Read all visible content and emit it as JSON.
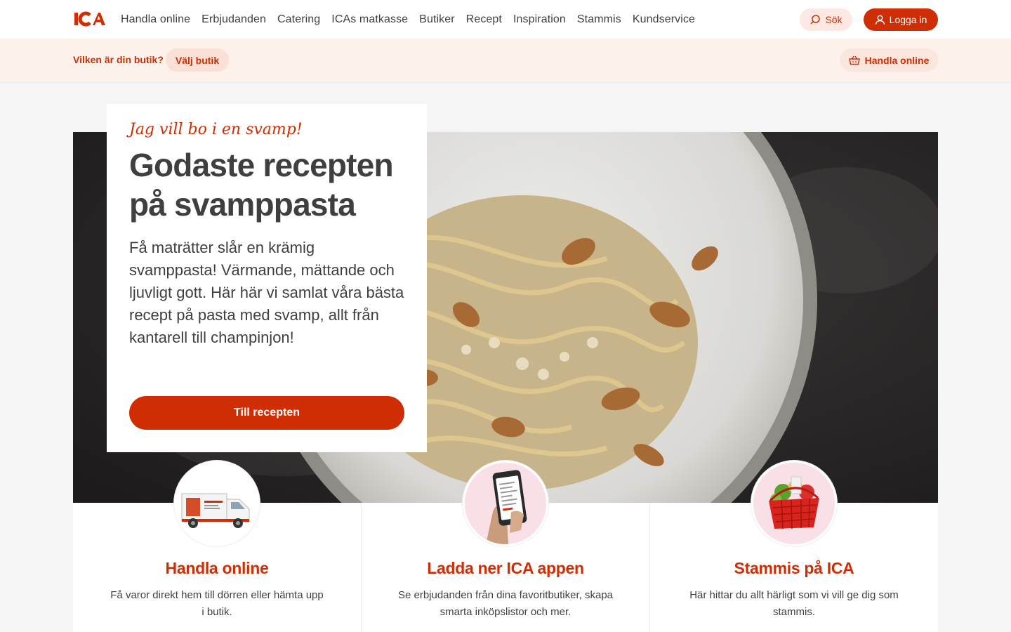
{
  "brand": {
    "name": "ICA",
    "color": "#cf2e05"
  },
  "nav": {
    "items": [
      "Handla online",
      "Erbjudanden",
      "Catering",
      "ICAs matkasse",
      "Butiker",
      "Recept",
      "Inspiration",
      "Stammis",
      "Kundservice"
    ],
    "search_label": "Sök",
    "login_label": "Logga in"
  },
  "store_bar": {
    "question": "Vilken är din butik?",
    "choose_label": "Välj butik",
    "shop_online_label": "Handla online"
  },
  "hero": {
    "tagline": "Jag vill bo i en svamp!",
    "title": "Godaste recepten på svamppasta",
    "text": "Få maträtter slår en krämig svamppasta! Värmande, mättande och ljuvligt gott. Här här vi samlat våra bästa recept på pasta med svamp, allt från kantarell till champinjon!",
    "cta": "Till recepten"
  },
  "cards": [
    {
      "title": "Handla online",
      "text": "Få varor direkt hem till dörren eller hämta upp i butik."
    },
    {
      "title": "Ladda ner ICA appen",
      "text": "Se erbjudanden från dina favoritbutiker, skapa smarta inköpslistor och mer."
    },
    {
      "title": "Stammis på ICA",
      "text": "Här hittar du allt härligt som vi vill ge dig som stammis."
    }
  ]
}
